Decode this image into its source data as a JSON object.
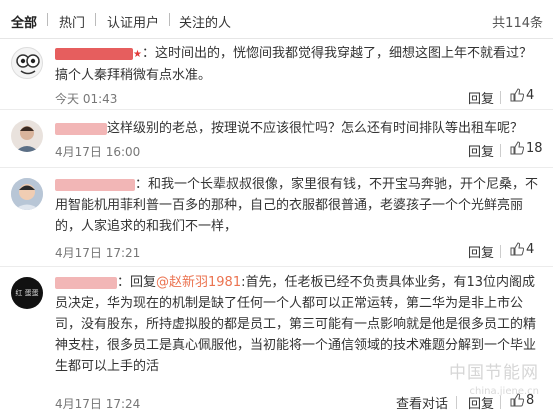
{
  "tabs": {
    "all": "全部",
    "hot": "热门",
    "verified": "认证用户",
    "following": "关注的人"
  },
  "total": "共114条",
  "comments": [
    {
      "text": "：这时间出的，恍惚间我都觉得我穿越了，细想这图上年不就看过？搞个人秦拜稍微有点水准。",
      "time": "今天 01:43",
      "reply_label": "回复",
      "likes": "4"
    },
    {
      "text": "这样级别的老总，按理说不应该很忙吗？怎么还有时间排队等出租车呢？",
      "time": "4月17日 16:00",
      "reply_label": "回复",
      "likes": "18"
    },
    {
      "text": "：和我一个长辈叔叔很像，家里很有钱，不开宝马奔驰，开个尼桑，不用智能机用菲利普一百多的那种，自己的衣服都很普通，老婆孩子一个个光鲜亮丽的，人家追求的和我们不一样，",
      "time": "4月17日 17:21",
      "reply_label": "回复",
      "likes": "4"
    },
    {
      "text_prefix": "：回复",
      "mention": "@赵新羽1981",
      "text": ":首先，任老板已经不负责具体业务，有13位内阁成员决定，华为现在的机制是缺了任何一个人都可以正常运转，第二华为是非上市公司，没有股东，所持虚拟股的都是员工，第三可能有一点影响就是他是很多员工的精神支柱，很多员工是真心佩服他，当初能将一个通信领域的技术难题分解到一个毕业生都可以上手的活",
      "avatar_text": "红 蛋蛋",
      "time": "4月17日 17:24",
      "view_label": "查看对话",
      "reply_label": "回复",
      "likes": "8"
    }
  ],
  "watermark": {
    "main": "中国节能网",
    "sub": "china.jiene.cn"
  },
  "colors": {
    "accent": "#eb7350",
    "name_red": "#e13a3a"
  }
}
